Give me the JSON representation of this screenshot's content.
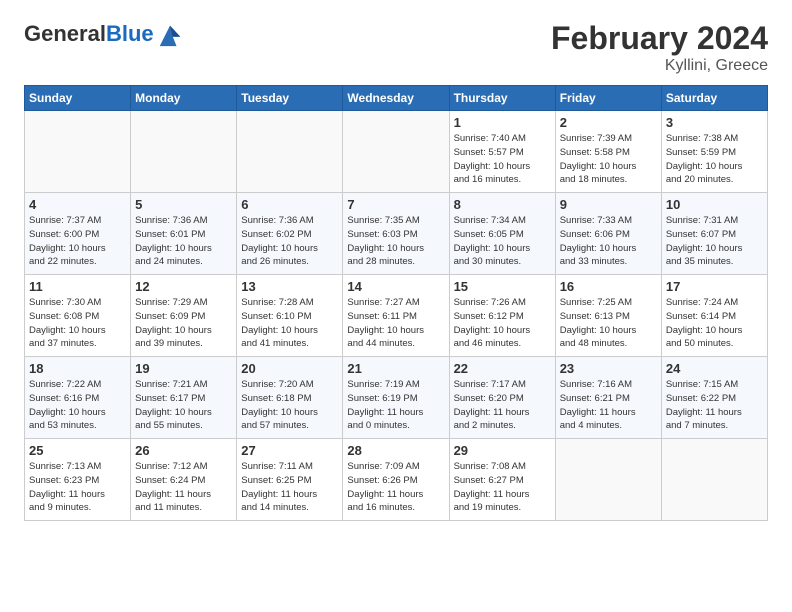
{
  "header": {
    "logo_general": "General",
    "logo_blue": "Blue",
    "title": "February 2024",
    "location": "Kyllini, Greece"
  },
  "columns": [
    "Sunday",
    "Monday",
    "Tuesday",
    "Wednesday",
    "Thursday",
    "Friday",
    "Saturday"
  ],
  "weeks": [
    {
      "days": [
        {
          "num": "",
          "info": ""
        },
        {
          "num": "",
          "info": ""
        },
        {
          "num": "",
          "info": ""
        },
        {
          "num": "",
          "info": ""
        },
        {
          "num": "1",
          "info": "Sunrise: 7:40 AM\nSunset: 5:57 PM\nDaylight: 10 hours\nand 16 minutes."
        },
        {
          "num": "2",
          "info": "Sunrise: 7:39 AM\nSunset: 5:58 PM\nDaylight: 10 hours\nand 18 minutes."
        },
        {
          "num": "3",
          "info": "Sunrise: 7:38 AM\nSunset: 5:59 PM\nDaylight: 10 hours\nand 20 minutes."
        }
      ]
    },
    {
      "days": [
        {
          "num": "4",
          "info": "Sunrise: 7:37 AM\nSunset: 6:00 PM\nDaylight: 10 hours\nand 22 minutes."
        },
        {
          "num": "5",
          "info": "Sunrise: 7:36 AM\nSunset: 6:01 PM\nDaylight: 10 hours\nand 24 minutes."
        },
        {
          "num": "6",
          "info": "Sunrise: 7:36 AM\nSunset: 6:02 PM\nDaylight: 10 hours\nand 26 minutes."
        },
        {
          "num": "7",
          "info": "Sunrise: 7:35 AM\nSunset: 6:03 PM\nDaylight: 10 hours\nand 28 minutes."
        },
        {
          "num": "8",
          "info": "Sunrise: 7:34 AM\nSunset: 6:05 PM\nDaylight: 10 hours\nand 30 minutes."
        },
        {
          "num": "9",
          "info": "Sunrise: 7:33 AM\nSunset: 6:06 PM\nDaylight: 10 hours\nand 33 minutes."
        },
        {
          "num": "10",
          "info": "Sunrise: 7:31 AM\nSunset: 6:07 PM\nDaylight: 10 hours\nand 35 minutes."
        }
      ]
    },
    {
      "days": [
        {
          "num": "11",
          "info": "Sunrise: 7:30 AM\nSunset: 6:08 PM\nDaylight: 10 hours\nand 37 minutes."
        },
        {
          "num": "12",
          "info": "Sunrise: 7:29 AM\nSunset: 6:09 PM\nDaylight: 10 hours\nand 39 minutes."
        },
        {
          "num": "13",
          "info": "Sunrise: 7:28 AM\nSunset: 6:10 PM\nDaylight: 10 hours\nand 41 minutes."
        },
        {
          "num": "14",
          "info": "Sunrise: 7:27 AM\nSunset: 6:11 PM\nDaylight: 10 hours\nand 44 minutes."
        },
        {
          "num": "15",
          "info": "Sunrise: 7:26 AM\nSunset: 6:12 PM\nDaylight: 10 hours\nand 46 minutes."
        },
        {
          "num": "16",
          "info": "Sunrise: 7:25 AM\nSunset: 6:13 PM\nDaylight: 10 hours\nand 48 minutes."
        },
        {
          "num": "17",
          "info": "Sunrise: 7:24 AM\nSunset: 6:14 PM\nDaylight: 10 hours\nand 50 minutes."
        }
      ]
    },
    {
      "days": [
        {
          "num": "18",
          "info": "Sunrise: 7:22 AM\nSunset: 6:16 PM\nDaylight: 10 hours\nand 53 minutes."
        },
        {
          "num": "19",
          "info": "Sunrise: 7:21 AM\nSunset: 6:17 PM\nDaylight: 10 hours\nand 55 minutes."
        },
        {
          "num": "20",
          "info": "Sunrise: 7:20 AM\nSunset: 6:18 PM\nDaylight: 10 hours\nand 57 minutes."
        },
        {
          "num": "21",
          "info": "Sunrise: 7:19 AM\nSunset: 6:19 PM\nDaylight: 11 hours\nand 0 minutes."
        },
        {
          "num": "22",
          "info": "Sunrise: 7:17 AM\nSunset: 6:20 PM\nDaylight: 11 hours\nand 2 minutes."
        },
        {
          "num": "23",
          "info": "Sunrise: 7:16 AM\nSunset: 6:21 PM\nDaylight: 11 hours\nand 4 minutes."
        },
        {
          "num": "24",
          "info": "Sunrise: 7:15 AM\nSunset: 6:22 PM\nDaylight: 11 hours\nand 7 minutes."
        }
      ]
    },
    {
      "days": [
        {
          "num": "25",
          "info": "Sunrise: 7:13 AM\nSunset: 6:23 PM\nDaylight: 11 hours\nand 9 minutes."
        },
        {
          "num": "26",
          "info": "Sunrise: 7:12 AM\nSunset: 6:24 PM\nDaylight: 11 hours\nand 11 minutes."
        },
        {
          "num": "27",
          "info": "Sunrise: 7:11 AM\nSunset: 6:25 PM\nDaylight: 11 hours\nand 14 minutes."
        },
        {
          "num": "28",
          "info": "Sunrise: 7:09 AM\nSunset: 6:26 PM\nDaylight: 11 hours\nand 16 minutes."
        },
        {
          "num": "29",
          "info": "Sunrise: 7:08 AM\nSunset: 6:27 PM\nDaylight: 11 hours\nand 19 minutes."
        },
        {
          "num": "",
          "info": ""
        },
        {
          "num": "",
          "info": ""
        }
      ]
    }
  ]
}
